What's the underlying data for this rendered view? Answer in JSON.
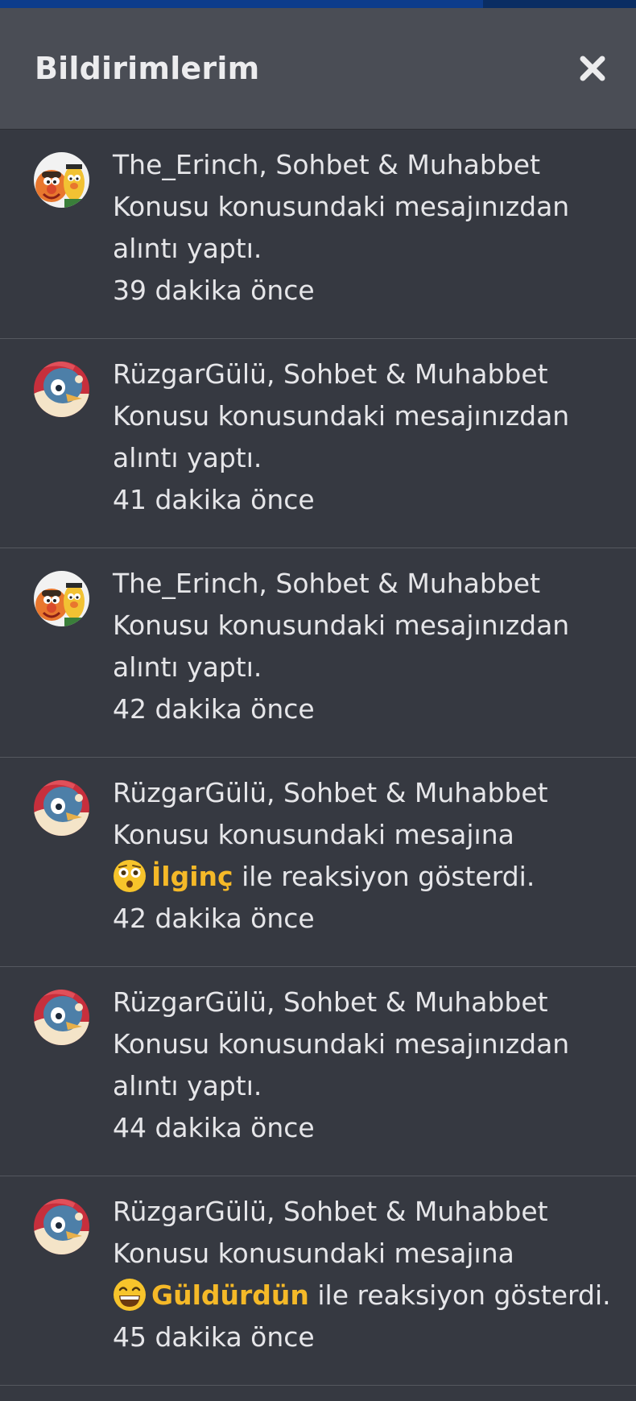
{
  "header": {
    "title": "Bildirimlerim",
    "close_icon": "close-icon",
    "accent_color": "#0d3c8b"
  },
  "notifications": [
    {
      "user": "The_Erinch",
      "avatar": "ernie-bert-avatar",
      "line1": "The_Erinch, Sohbet & Muhabbet",
      "line2": "Konusu konusundaki mesajınızdan",
      "line3": "alıntı yaptı.",
      "time": "39 dakika önce"
    },
    {
      "user": "RüzgarGülü",
      "avatar": "cartoon-bird-avatar",
      "line1": "RüzgarGülü, Sohbet & Muhabbet",
      "line2": "Konusu konusundaki mesajınızdan",
      "line3": "alıntı yaptı.",
      "time": "41 dakika önce"
    },
    {
      "user": "The_Erinch",
      "avatar": "ernie-bert-avatar",
      "line1": "The_Erinch, Sohbet & Muhabbet",
      "line2": "Konusu konusundaki mesajınızdan",
      "line3": "alıntı yaptı.",
      "time": "42 dakika önce"
    },
    {
      "user": "RüzgarGülü",
      "avatar": "cartoon-bird-avatar",
      "line1": "RüzgarGülü, Sohbet & Muhabbet",
      "line2": "Konusu konusundaki mesajına",
      "reaction_icon": "flushed-face-emoji",
      "reaction": "İlginç",
      "reaction_suffix": " ile reaksiyon gösterdi.",
      "time": "42 dakika önce"
    },
    {
      "user": "RüzgarGülü",
      "avatar": "cartoon-bird-avatar",
      "line1": "RüzgarGülü, Sohbet & Muhabbet",
      "line2": "Konusu konusundaki mesajınızdan",
      "line3": "alıntı yaptı.",
      "time": "44 dakika önce"
    },
    {
      "user": "RüzgarGülü",
      "avatar": "cartoon-bird-avatar",
      "line1": "RüzgarGülü, Sohbet & Muhabbet",
      "line2": "Konusu konusundaki mesajına",
      "reaction_icon": "grinning-face-emoji",
      "reaction": "Güldürdün",
      "reaction_suffix": " ile reaksiyon gösterdi.",
      "time": "45 dakika önce"
    }
  ],
  "colors": {
    "panel_bg": "#363941",
    "header_bg": "#4a4d55",
    "reaction_label": "#f5b928"
  }
}
